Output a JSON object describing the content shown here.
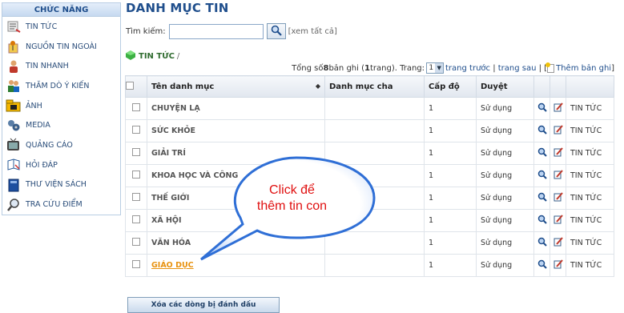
{
  "sidebar": {
    "title": "CHỨC NĂNG",
    "items": [
      {
        "label": "TIN TỨC",
        "icon": "news-icon"
      },
      {
        "label": "NGUỒN TIN NGOÀI",
        "icon": "external-source-icon"
      },
      {
        "label": "TIN NHANH",
        "icon": "quick-news-icon"
      },
      {
        "label": "THĂM DÒ Ý KIẾN",
        "icon": "poll-icon"
      },
      {
        "label": "ẢNH",
        "icon": "photo-icon"
      },
      {
        "label": "MEDIA",
        "icon": "media-icon"
      },
      {
        "label": "QUẢNG CÁO",
        "icon": "tv-ad-icon"
      },
      {
        "label": "HỎI ĐÁP",
        "icon": "qa-icon"
      },
      {
        "label": "THƯ VIỆN SÁCH",
        "icon": "book-icon"
      },
      {
        "label": "TRA CỨU ĐIỂM",
        "icon": "lookup-icon"
      }
    ]
  },
  "header": {
    "title": "DANH MỤC TIN"
  },
  "search": {
    "label": "Tìm kiếm:",
    "value": "",
    "view_all": "[xem tất cả]"
  },
  "breadcrumb": {
    "current": "TIN TỨC",
    "separator": "/"
  },
  "pager": {
    "prefix": "Tổng số ",
    "total": "8",
    "middle1": " bản ghi (",
    "pages": "1",
    "middle2": " trang). Trang: ",
    "current_page": "1",
    "prev": "trang trước",
    "divider": " | ",
    "next": "trang sau",
    "add_prefix": " | [",
    "add_label": "Thêm bản ghi",
    "add_suffix": "]"
  },
  "table": {
    "headers": {
      "name": "Tên danh mục",
      "parent": "Danh mục cha",
      "level": "Cấp độ",
      "approve": "Duyệt"
    },
    "rows": [
      {
        "name": "CHUYỆN LẠ",
        "parent": "",
        "level": "1",
        "status": "Sử dụng",
        "link": "TIN TỨC"
      },
      {
        "name": "SỨC KHỎE",
        "parent": "",
        "level": "1",
        "status": "Sử dụng",
        "link": "TIN TỨC"
      },
      {
        "name": "GIẢI TRÍ",
        "parent": "",
        "level": "1",
        "status": "Sử dụng",
        "link": "TIN TỨC"
      },
      {
        "name": "KHOA HỌC VÀ CÔNG",
        "parent": "",
        "level": "1",
        "status": "Sử dụng",
        "link": "TIN TỨC"
      },
      {
        "name": "THẾ GIỚI",
        "parent": "",
        "level": "1",
        "status": "Sử dụng",
        "link": "TIN TỨC"
      },
      {
        "name": "XÃ HỘI",
        "parent": "",
        "level": "1",
        "status": "Sử dụng",
        "link": "TIN TỨC"
      },
      {
        "name": "VĂN HÓA",
        "parent": "",
        "level": "1",
        "status": "Sử dụng",
        "link": "TIN TỨC"
      },
      {
        "name": "GIÁO DỤC",
        "parent": "",
        "level": "1",
        "status": "Sử dụng",
        "link": "TIN TỨC"
      }
    ]
  },
  "bottom_button": "Xóa các dòng bị đánh dấu",
  "callout": {
    "line1": "Click để",
    "line2": "thêm tin con"
  },
  "colors": {
    "title_blue": "#1f4e8c",
    "active_orange": "#e8920f",
    "callout_red": "#e01010",
    "callout_fill": "#2f6fd6"
  }
}
